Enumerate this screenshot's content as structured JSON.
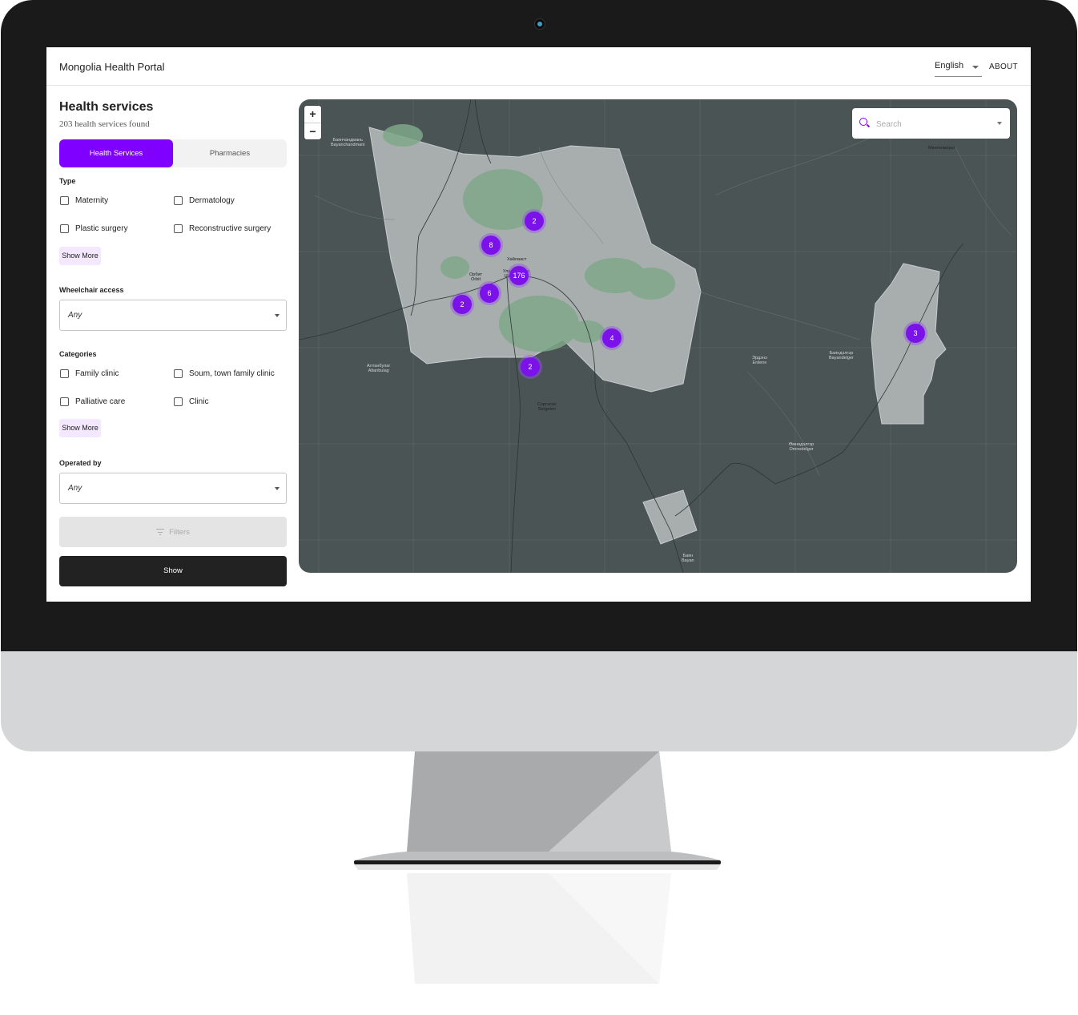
{
  "app": {
    "title": "Mongolia Health Portal"
  },
  "header": {
    "language": "English",
    "about": "ABOUT"
  },
  "sidebar": {
    "heading": "Health services",
    "found": "203 health services found",
    "tabs": [
      {
        "label": "Health Services",
        "active": true
      },
      {
        "label": "Pharmacies",
        "active": false
      }
    ],
    "type": {
      "label": "Type",
      "options": [
        "Maternity",
        "Dermatology",
        "Plastic surgery",
        "Reconstructive surgery"
      ],
      "show_more": "Show More"
    },
    "wheelchair": {
      "label": "Wheelchair access",
      "value": "Any"
    },
    "categories": {
      "label": "Categories",
      "options": [
        "Family clinic",
        "Soum, town family clinic",
        "Palliative care",
        "Clinic"
      ],
      "show_more": "Show More"
    },
    "operated_by": {
      "label": "Operated by",
      "value": "Any"
    },
    "filters_label": "Filters",
    "show_label": "Show"
  },
  "map": {
    "zoom_in": "+",
    "zoom_out": "−",
    "search_placeholder": "Search",
    "clusters": [
      "2",
      "8",
      "176",
      "6",
      "2",
      "4",
      "2",
      "3"
    ],
    "labels": [
      "Хайлааст",
      "Орбит\nOrbit",
      "Улаанбаатар\nUlaanbaatar",
      "Баянчандмань\nBayanchandmani",
      "Алтанбулаг\nAltanbulag",
      "Сэргэлэн\nSergelen",
      "Эрдэнэ\nErdene",
      "Баяндэлгэр\nBayandelger",
      "Мөнгөнморьт",
      "Өмнөдэлгэр\nOmnodelger",
      "Баян\nBayan"
    ],
    "colors": {
      "base": "#4a5455",
      "region": "#a8adad",
      "cluster": "#7b12ea"
    }
  },
  "colors": {
    "accent": "#8000ff",
    "dark_button": "#222222"
  }
}
